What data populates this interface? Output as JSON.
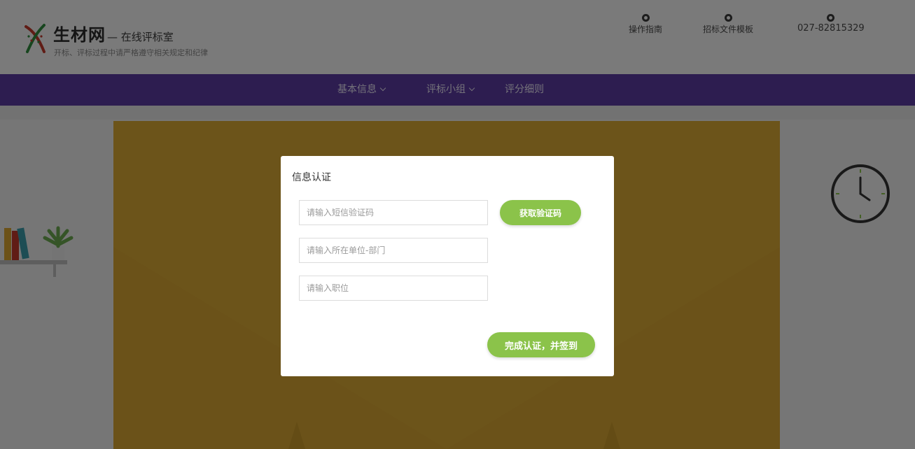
{
  "header": {
    "brand_name": "生材网",
    "brand_sub": "— 在线评标室",
    "tagline": "开标、评标过程中请严格遵守相关规定和纪律",
    "links": [
      {
        "label": "操作指南",
        "icon": "guide-icon"
      },
      {
        "label": "招标文件模板",
        "icon": "template-icon"
      },
      {
        "label": "027-82815329",
        "icon": "phone-icon"
      }
    ]
  },
  "nav": {
    "items": [
      {
        "label": "基本信息",
        "has_dropdown": true
      },
      {
        "label": "评标小组",
        "has_dropdown": true
      },
      {
        "label": "评分细则",
        "has_dropdown": false
      }
    ]
  },
  "modal": {
    "title": "信息认证",
    "sms_code_placeholder": "请输入短信验证码",
    "get_code_label": "获取验证码",
    "unit_placeholder": "请输入所在单位-部门",
    "position_placeholder": "请输入职位",
    "submit_label": "完成认证，并签到"
  },
  "colors": {
    "nav_bg": "#5a3aa0",
    "accent_green": "#8bc34a",
    "board": "#d9a935"
  }
}
